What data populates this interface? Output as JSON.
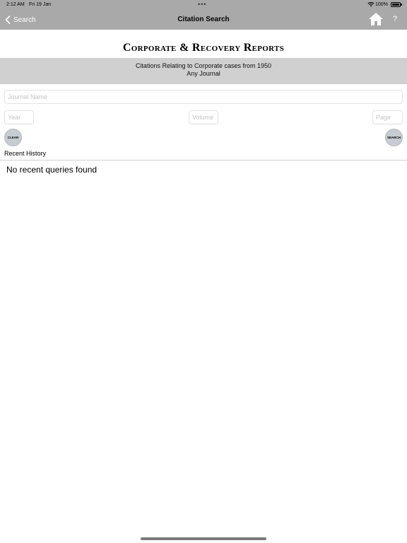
{
  "status_bar": {
    "time": "2:12 AM",
    "date": "Fri 19 Jan",
    "dots": "•••",
    "battery": "100%"
  },
  "nav": {
    "back_label": "Search",
    "title": "Citation Search",
    "help_label": "?",
    "home_icon": "home-icon"
  },
  "brand": {
    "title": "Corporate & Recovery Reports"
  },
  "banner": {
    "line1": "Citations Relating to Corporate cases from 1950",
    "line2": "Any Journal"
  },
  "form": {
    "journal_placeholder": "Journal Name",
    "journal_value": "",
    "year_placeholder": "Year",
    "year_value": "",
    "volume_placeholder": "Volume",
    "volume_value": "",
    "page_placeholder": "Page",
    "page_value": "",
    "clear_label": "CLEAR",
    "search_label": "SEARCH"
  },
  "history": {
    "heading": "Recent History",
    "empty_message": "No recent queries found"
  },
  "colors": {
    "nav_bar": "#a9a9a9",
    "banner": "#d0d0d0",
    "round_button": "#c6ccd1"
  }
}
